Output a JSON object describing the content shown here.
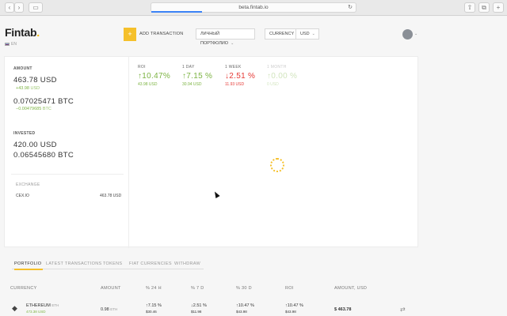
{
  "browser": {
    "url": "beta.fintab.io",
    "back_glyph": "‹",
    "forward_glyph": "›",
    "sidebar_glyph": "▭",
    "reload_glyph": "↻",
    "share_glyph": "⇧",
    "tabs_glyph": "⧉",
    "plus_glyph": "+"
  },
  "header": {
    "logo": "Fintab",
    "language": "EN",
    "add_icon": "+",
    "add_transaction": "ADD TRANSACTION",
    "portfolio": "ЛИЧНЫЙ ПОРТФОЛИО",
    "currency_label": "CURRENCY",
    "currency_value": "USD",
    "chevron": "⌄"
  },
  "summary": {
    "amount_label": "AMOUNT",
    "amount_usd": "463.78 USD",
    "amount_usd_change": "+43.98",
    "amount_usd_change_unit": "USD",
    "amount_btc": "0.07025471 BTC",
    "amount_btc_change": "−0.00479685",
    "amount_btc_change_unit": "BTC",
    "invested_label": "INVESTED",
    "invested_usd": "420.00 USD",
    "invested_btc": "0.06545680 BTC",
    "exchange_label": "EXCHANGE",
    "exchange_name": "CEX.IO",
    "exchange_value": "463.78 USD"
  },
  "stats": [
    {
      "label": "ROI",
      "value": "↑10.47%",
      "sub": "43.98 USD",
      "tone": "green",
      "faded": false
    },
    {
      "label": "1 DAY",
      "value": "↑7.15 %",
      "sub": "30.94 USD",
      "tone": "green",
      "faded": false
    },
    {
      "label": "1 WEEK",
      "value": "↓2.51 %",
      "sub": "11.93 USD",
      "tone": "red",
      "faded": false
    },
    {
      "label": "1 MONTH",
      "value": "↑0.00 %",
      "sub": "0 USD",
      "tone": "green",
      "faded": true
    }
  ],
  "tabs": [
    "PORTFOLIO",
    "LATEST TRANSACTIONS",
    "TOKENS",
    "FIAT CURRENCIES",
    "WITHDRAW"
  ],
  "table": {
    "headers": [
      "CURRENCY",
      "AMOUNT",
      "% 24 H",
      "% 7 D",
      "% 30 D",
      "ROI",
      "AMOUNT, USD"
    ],
    "rows": [
      {
        "icon": "◆",
        "name": "ETHEREUM",
        "ticker": "ETH",
        "price": "473.38 USD",
        "amount": "0.98",
        "amount_unit": "ETH",
        "d24": "↑7.15 %",
        "d24_usd": "$30.46",
        "d7": "↓2.51 %",
        "d7_usd": "$11.98",
        "d30": "↑10.47 %",
        "d30_usd": "$43.98",
        "roi": "↑10.47 %",
        "roi_usd": "$43.98",
        "total": "$ 463.78",
        "swap_icon": "⇄"
      }
    ]
  },
  "colors": {
    "accent": "#f5c02b",
    "green": "#7cb342",
    "red": "#e53935"
  }
}
